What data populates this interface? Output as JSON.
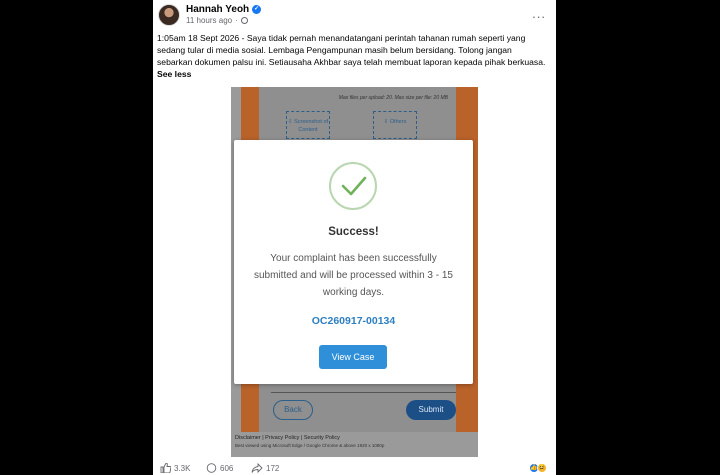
{
  "post": {
    "author": "Hannah Yeoh",
    "time": "11 hours ago",
    "dot_sep": "·",
    "text": "1:05am 18 Sept 2026 - Saya tidak pernah menandatangani perintah tahanan rumah seperti yang sedang tular di media sosial. Lembaga Pengampunan masih belum bersidang. Tolong jangan sebarkan dokumen palsu ini. Setiausaha Akhbar saya telah membuat laporan kepada pihak berkuasa.",
    "see_less": "See less",
    "more_icon": "..."
  },
  "screenshot": {
    "upload_limit": "Max files per upload: 20. Max size per file: 20 MB",
    "upload_1": "Screenshot of Content",
    "upload_2": "Others",
    "back_label": "Back",
    "submit_label": "Submit",
    "footer_links": "Disclaimer | Privacy Policy | Security Policy",
    "footer_note": "Best viewed using Microsoft Edge / Google Chrome & above 1920 x 1080p"
  },
  "modal": {
    "title": "Success!",
    "message": "Your complaint has been successfully submitted and will be processed within 3 - 15 working days.",
    "case_id": "OC260917-00134",
    "button": "View Case"
  },
  "stats": {
    "likes": "3.3K",
    "comments": "606",
    "shares": "172"
  },
  "colors": {
    "accent": "#2f8fd9",
    "case_id": "#2d7fc1",
    "fb_blue": "#1877f2",
    "check_green": "#6fb25a"
  }
}
